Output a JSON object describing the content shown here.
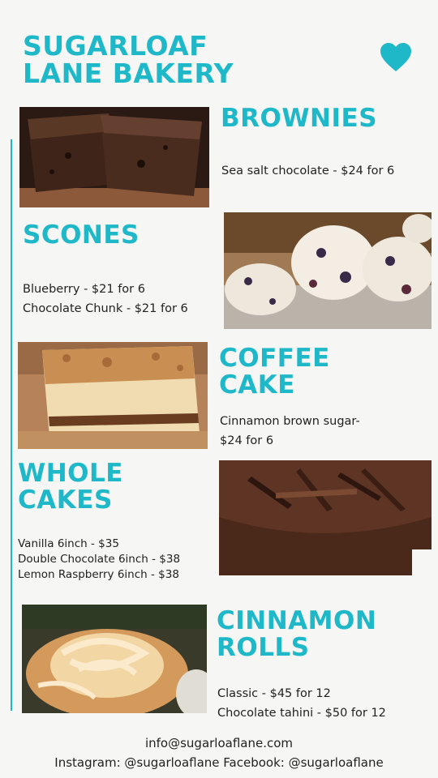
{
  "brand": {
    "line1": "SUGARLOAF",
    "line2": "LANE BAKERY"
  },
  "icons": {
    "heart": "heart-icon"
  },
  "colors": {
    "accent": "#1fb8c9"
  },
  "sections": [
    {
      "title_lines": [
        "BROWNIES"
      ],
      "items": [
        "Sea salt chocolate - $24 for 6"
      ]
    },
    {
      "title_lines": [
        "SCONES"
      ],
      "items": [
        "Blueberry - $21 for 6",
        "Chocolate Chunk - $21 for 6"
      ]
    },
    {
      "title_lines": [
        "COFFEE",
        "CAKE"
      ],
      "items": [
        "Cinnamon brown sugar-",
        "$24 for 6"
      ]
    },
    {
      "title_lines": [
        "WHOLE",
        "CAKES"
      ],
      "items": [
        "Vanilla 6inch - $35",
        "Double Chocolate 6inch - $38",
        "Lemon Raspberry 6inch - $38"
      ]
    },
    {
      "title_lines": [
        "CINNAMON",
        "ROLLS"
      ],
      "items": [
        "Classic - $45 for 12",
        "Chocolate tahini - $50 for 12"
      ]
    }
  ],
  "footer": {
    "email": "info@sugarloaflane.com",
    "social": "Instagram: @sugarloaflane Facebook: @sugarloaflane"
  }
}
